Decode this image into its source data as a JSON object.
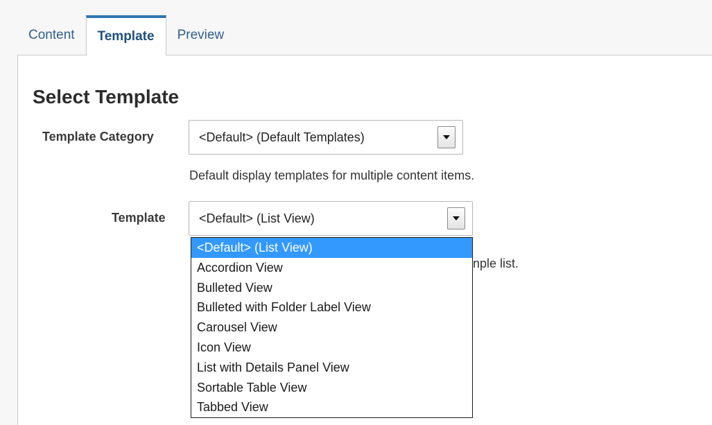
{
  "tabs": [
    {
      "label": "Content",
      "active": false
    },
    {
      "label": "Template",
      "active": true
    },
    {
      "label": "Preview",
      "active": false
    }
  ],
  "section_title": "Select Template",
  "template_category": {
    "label": "Template Category",
    "value": "<Default> (Default Templates)",
    "help": "Default display templates for multiple content items."
  },
  "template": {
    "label": "Template",
    "value": "<Default> (List View)",
    "help_partial": "nple list.",
    "options": [
      "<Default> (List View)",
      "Accordion View",
      "Bulleted View",
      "Bulleted with Folder Label View",
      "Carousel View",
      "Icon View",
      "List with Details Panel View",
      "Sortable Table View",
      "Tabbed View"
    ],
    "selected_index": 0
  },
  "colors": {
    "tab_accent": "#2f74b5",
    "tab_text": "#2f5f8f",
    "selection_highlight": "#3399ff"
  }
}
